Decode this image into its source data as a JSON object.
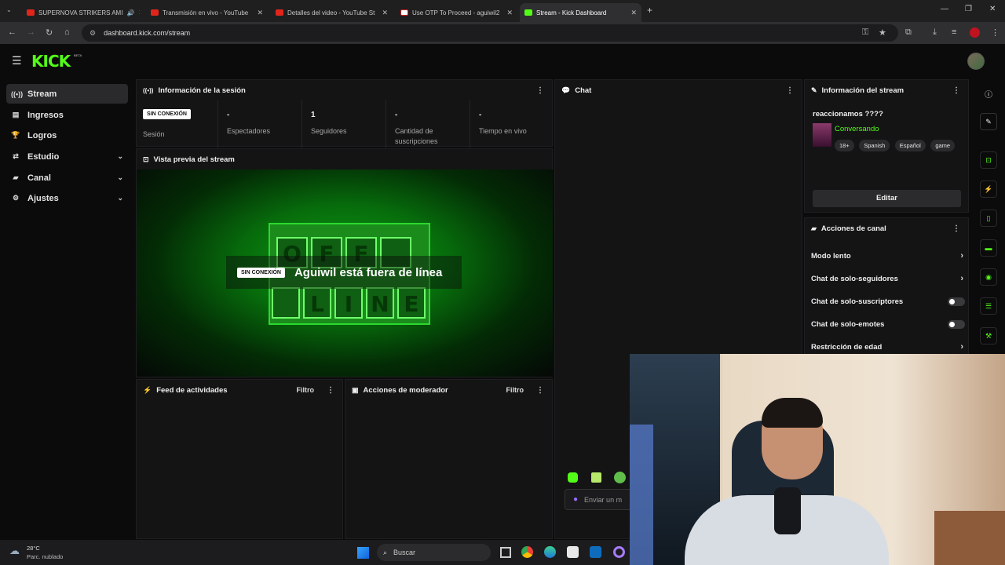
{
  "browser": {
    "tabs": [
      {
        "title": "SUPERNOVA STRIKERS AMI",
        "favicon": "youtube-favicon"
      },
      {
        "title": "Transmisión en vivo - YouTube",
        "favicon": "youtube-favicon"
      },
      {
        "title": "Detalles del video - YouTube St",
        "favicon": "youtube-favicon"
      },
      {
        "title": "Use OTP To Proceed - aguiwil2",
        "favicon": "gmail-favicon"
      },
      {
        "title": "Stream - Kick Dashboard",
        "favicon": "kick-favicon"
      }
    ],
    "url": "dashboard.kick.com/stream"
  },
  "header": {
    "logo": "KICK",
    "beta": "BETA"
  },
  "sidebar": {
    "items": [
      {
        "label": "Stream",
        "icon": "broadcast-icon"
      },
      {
        "label": "Ingresos",
        "icon": "money-icon"
      },
      {
        "label": "Logros",
        "icon": "trophy-icon"
      },
      {
        "label": "Estudio",
        "icon": "studio-icon"
      },
      {
        "label": "Canal",
        "icon": "channel-icon"
      },
      {
        "label": "Ajustes",
        "icon": "gear-icon"
      }
    ]
  },
  "session": {
    "title": "Información de la sesión",
    "status_badge": "SIN CONEXIÓN",
    "status_label": "Sesión",
    "stats": [
      {
        "value": "-",
        "label": "Espectadores"
      },
      {
        "value": "1",
        "label": "Seguidores"
      },
      {
        "value": "-",
        "label": "Cantidad de suscripciones"
      },
      {
        "value": "-",
        "label": "Tiempo en vivo"
      }
    ]
  },
  "preview": {
    "title": "Vista previa del stream",
    "badge": "SIN CONEXIÓN",
    "message": "Aguiwil está fuera de línea",
    "sign_top": [
      "O",
      "F",
      "F",
      ""
    ],
    "sign_bottom": [
      "",
      "L",
      "I",
      "N",
      "E"
    ]
  },
  "chat": {
    "title": "Chat",
    "input_placeholder": "Enviar un m"
  },
  "feed": {
    "title": "Feed de actividades",
    "filter": "Filtro"
  },
  "mod": {
    "title": "Acciones de moderador",
    "filter": "Filtro"
  },
  "stream_info": {
    "title": "Información del stream",
    "stream_title": "reaccionamos ????",
    "category": "Conversando",
    "category_color": "#53fc18",
    "tags": [
      "18+",
      "Spanish",
      "Español",
      "game"
    ],
    "edit_button": "Editar"
  },
  "channel_actions": {
    "title": "Acciones de canal",
    "items": [
      {
        "label": "Modo lento",
        "control": "arrow"
      },
      {
        "label": "Chat de solo-seguidores",
        "control": "arrow"
      },
      {
        "label": "Chat de solo-suscriptores",
        "control": "toggle"
      },
      {
        "label": "Chat de solo-emotes",
        "control": "toggle"
      },
      {
        "label": "Restricción de edad",
        "control": "arrow"
      }
    ]
  },
  "taskbar": {
    "temperature": "28°C",
    "weather": "Parc. nublado",
    "search": "Buscar"
  },
  "colors": {
    "accent": "#53fc18",
    "panel": "#141415",
    "background": "#0b0b0c"
  }
}
